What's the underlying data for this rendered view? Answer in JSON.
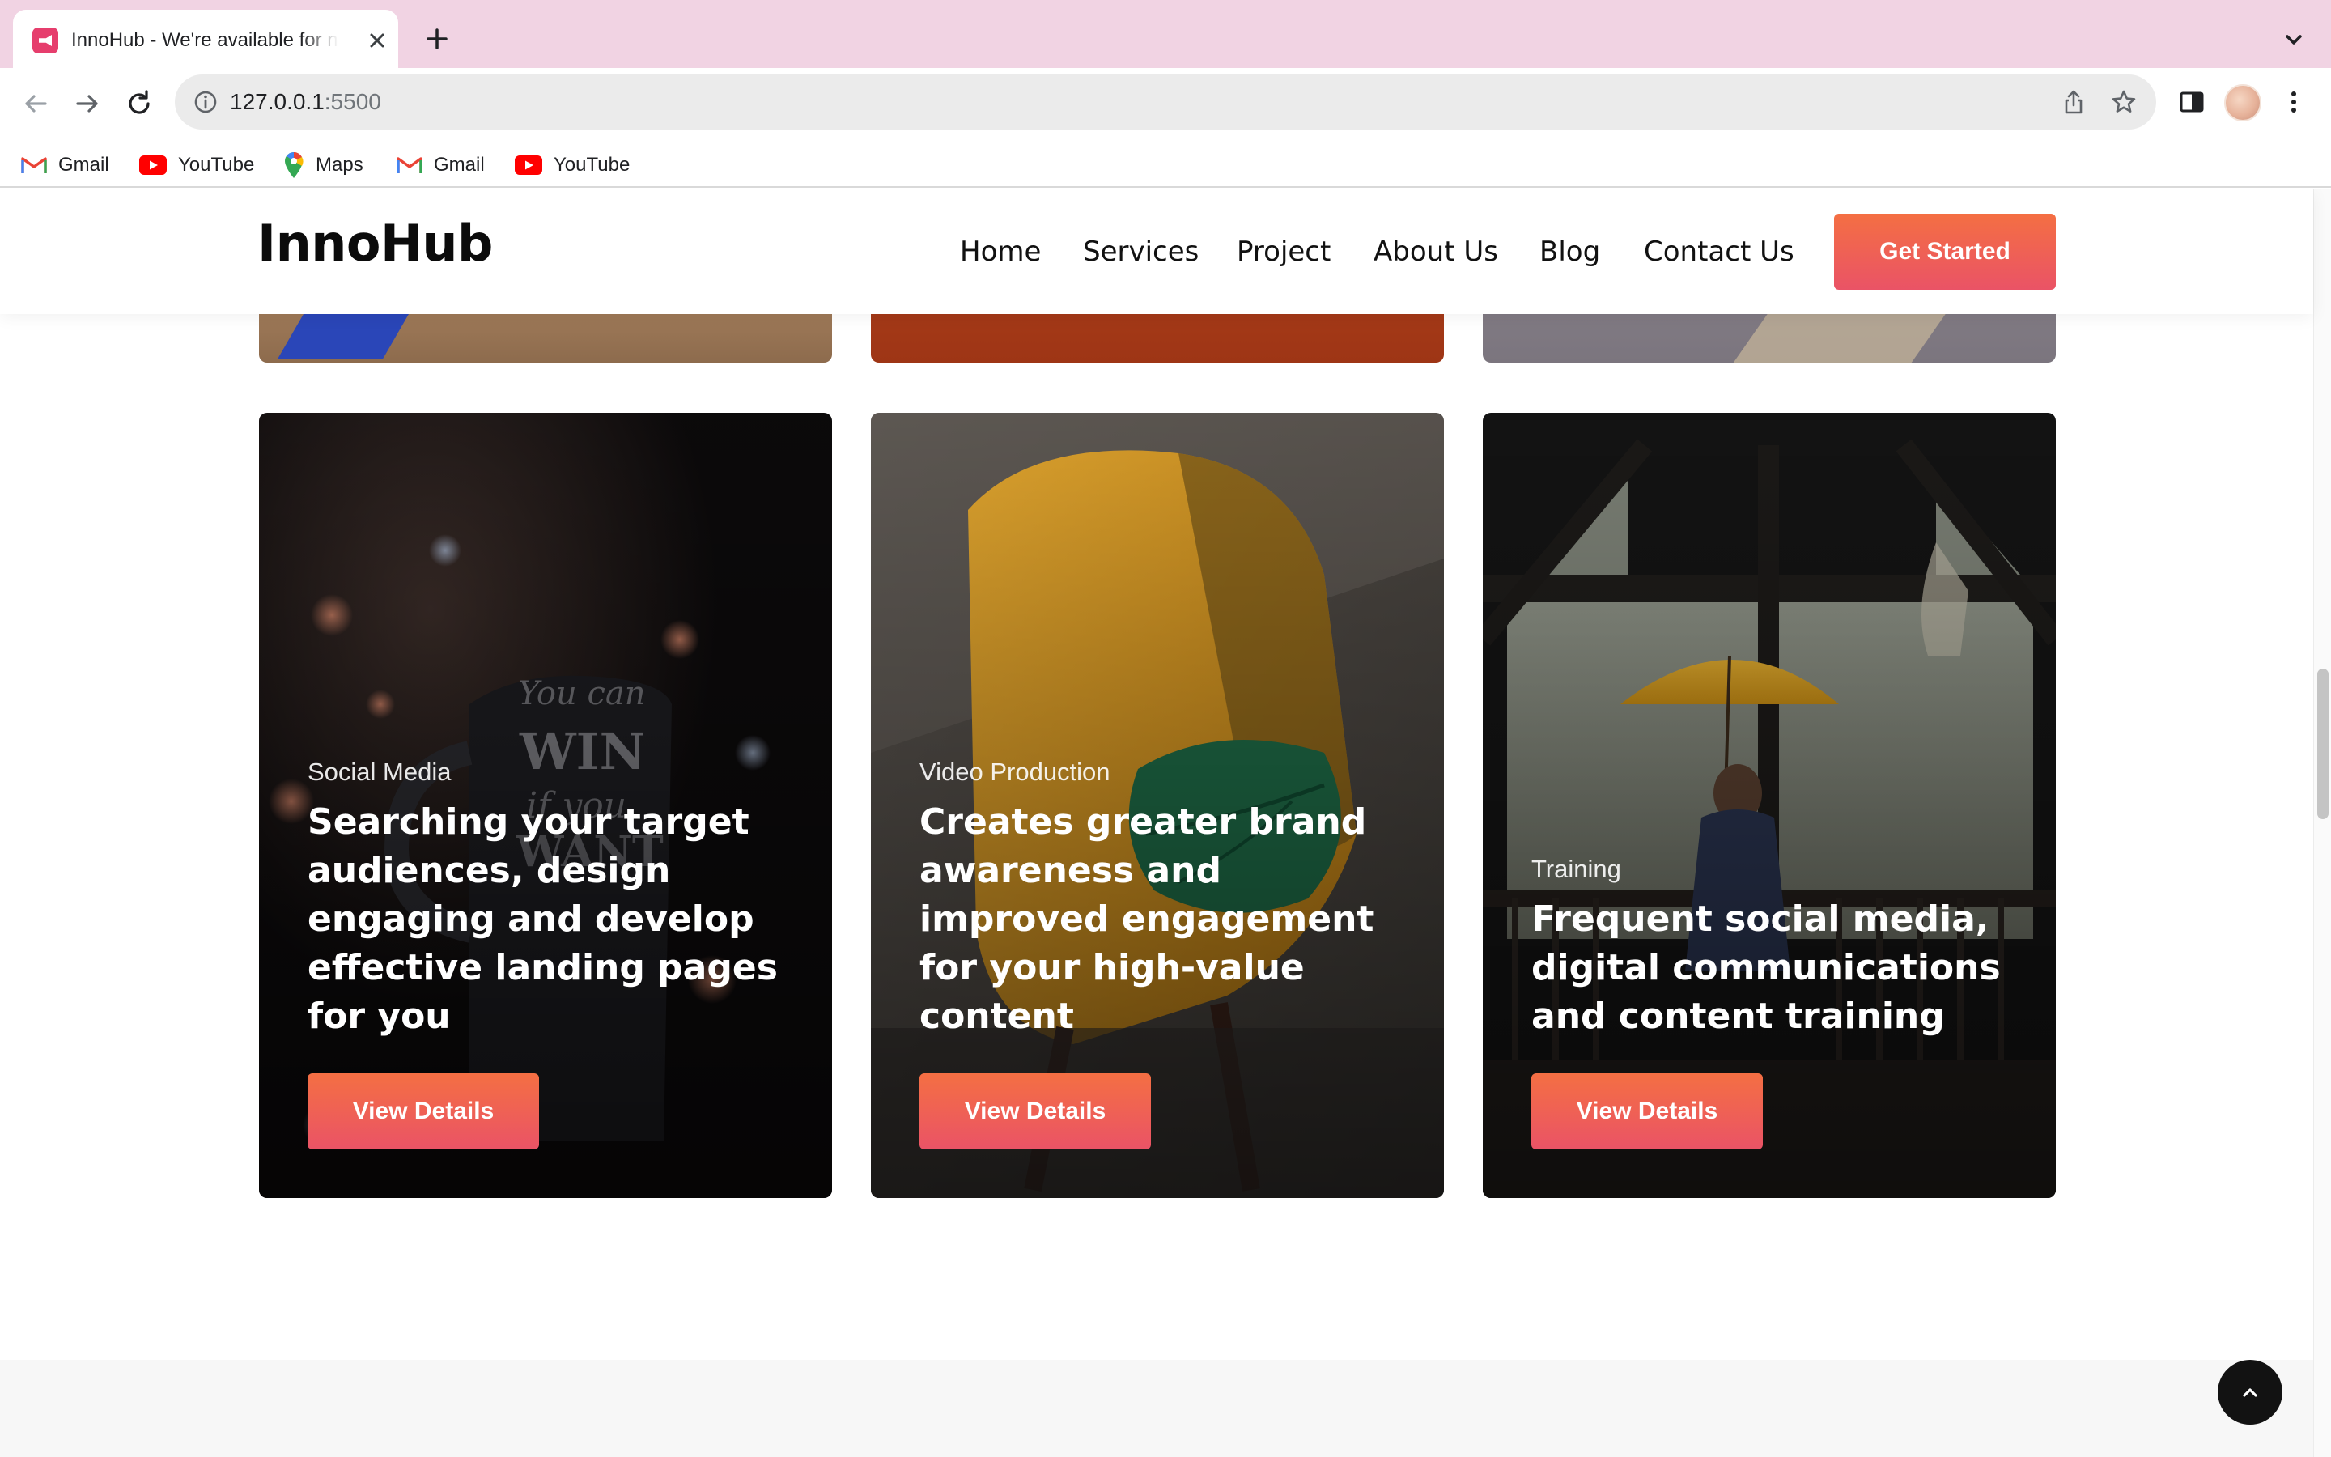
{
  "browser": {
    "tab_title": "InnoHub - We're available for n",
    "url_host": "127.0.0.1",
    "url_port": ":5500",
    "bookmarks": [
      {
        "label": "Gmail",
        "icon": "gmail-icon"
      },
      {
        "label": "YouTube",
        "icon": "youtube-icon"
      },
      {
        "label": "Maps",
        "icon": "maps-icon"
      },
      {
        "label": "Gmail",
        "icon": "gmail-icon"
      },
      {
        "label": "YouTube",
        "icon": "youtube-icon"
      }
    ]
  },
  "header": {
    "logo": "InnoHub",
    "nav": [
      "Home",
      "Services",
      "Project",
      "About Us",
      "Blog",
      "Contact Us"
    ],
    "cta_label": "Get Started"
  },
  "cards": [
    {
      "category": "Social Media",
      "title": "Searching your target audiences, design engaging and develop effective landing pages for you",
      "button": "View Details",
      "image": "mug-photo"
    },
    {
      "category": "Video Production",
      "title": "Creates greater brand awareness and improved engagement for your high-value content",
      "button": "View Details",
      "image": "chair-photo"
    },
    {
      "category": "Training",
      "title": "Frequent social media, digital communications and content training",
      "button": "View Details",
      "image": "umbrella-photo"
    }
  ],
  "colors": {
    "accent_start": "#f46f43",
    "accent_end": "#ea5366",
    "tabbar": "#f1d3e3"
  }
}
